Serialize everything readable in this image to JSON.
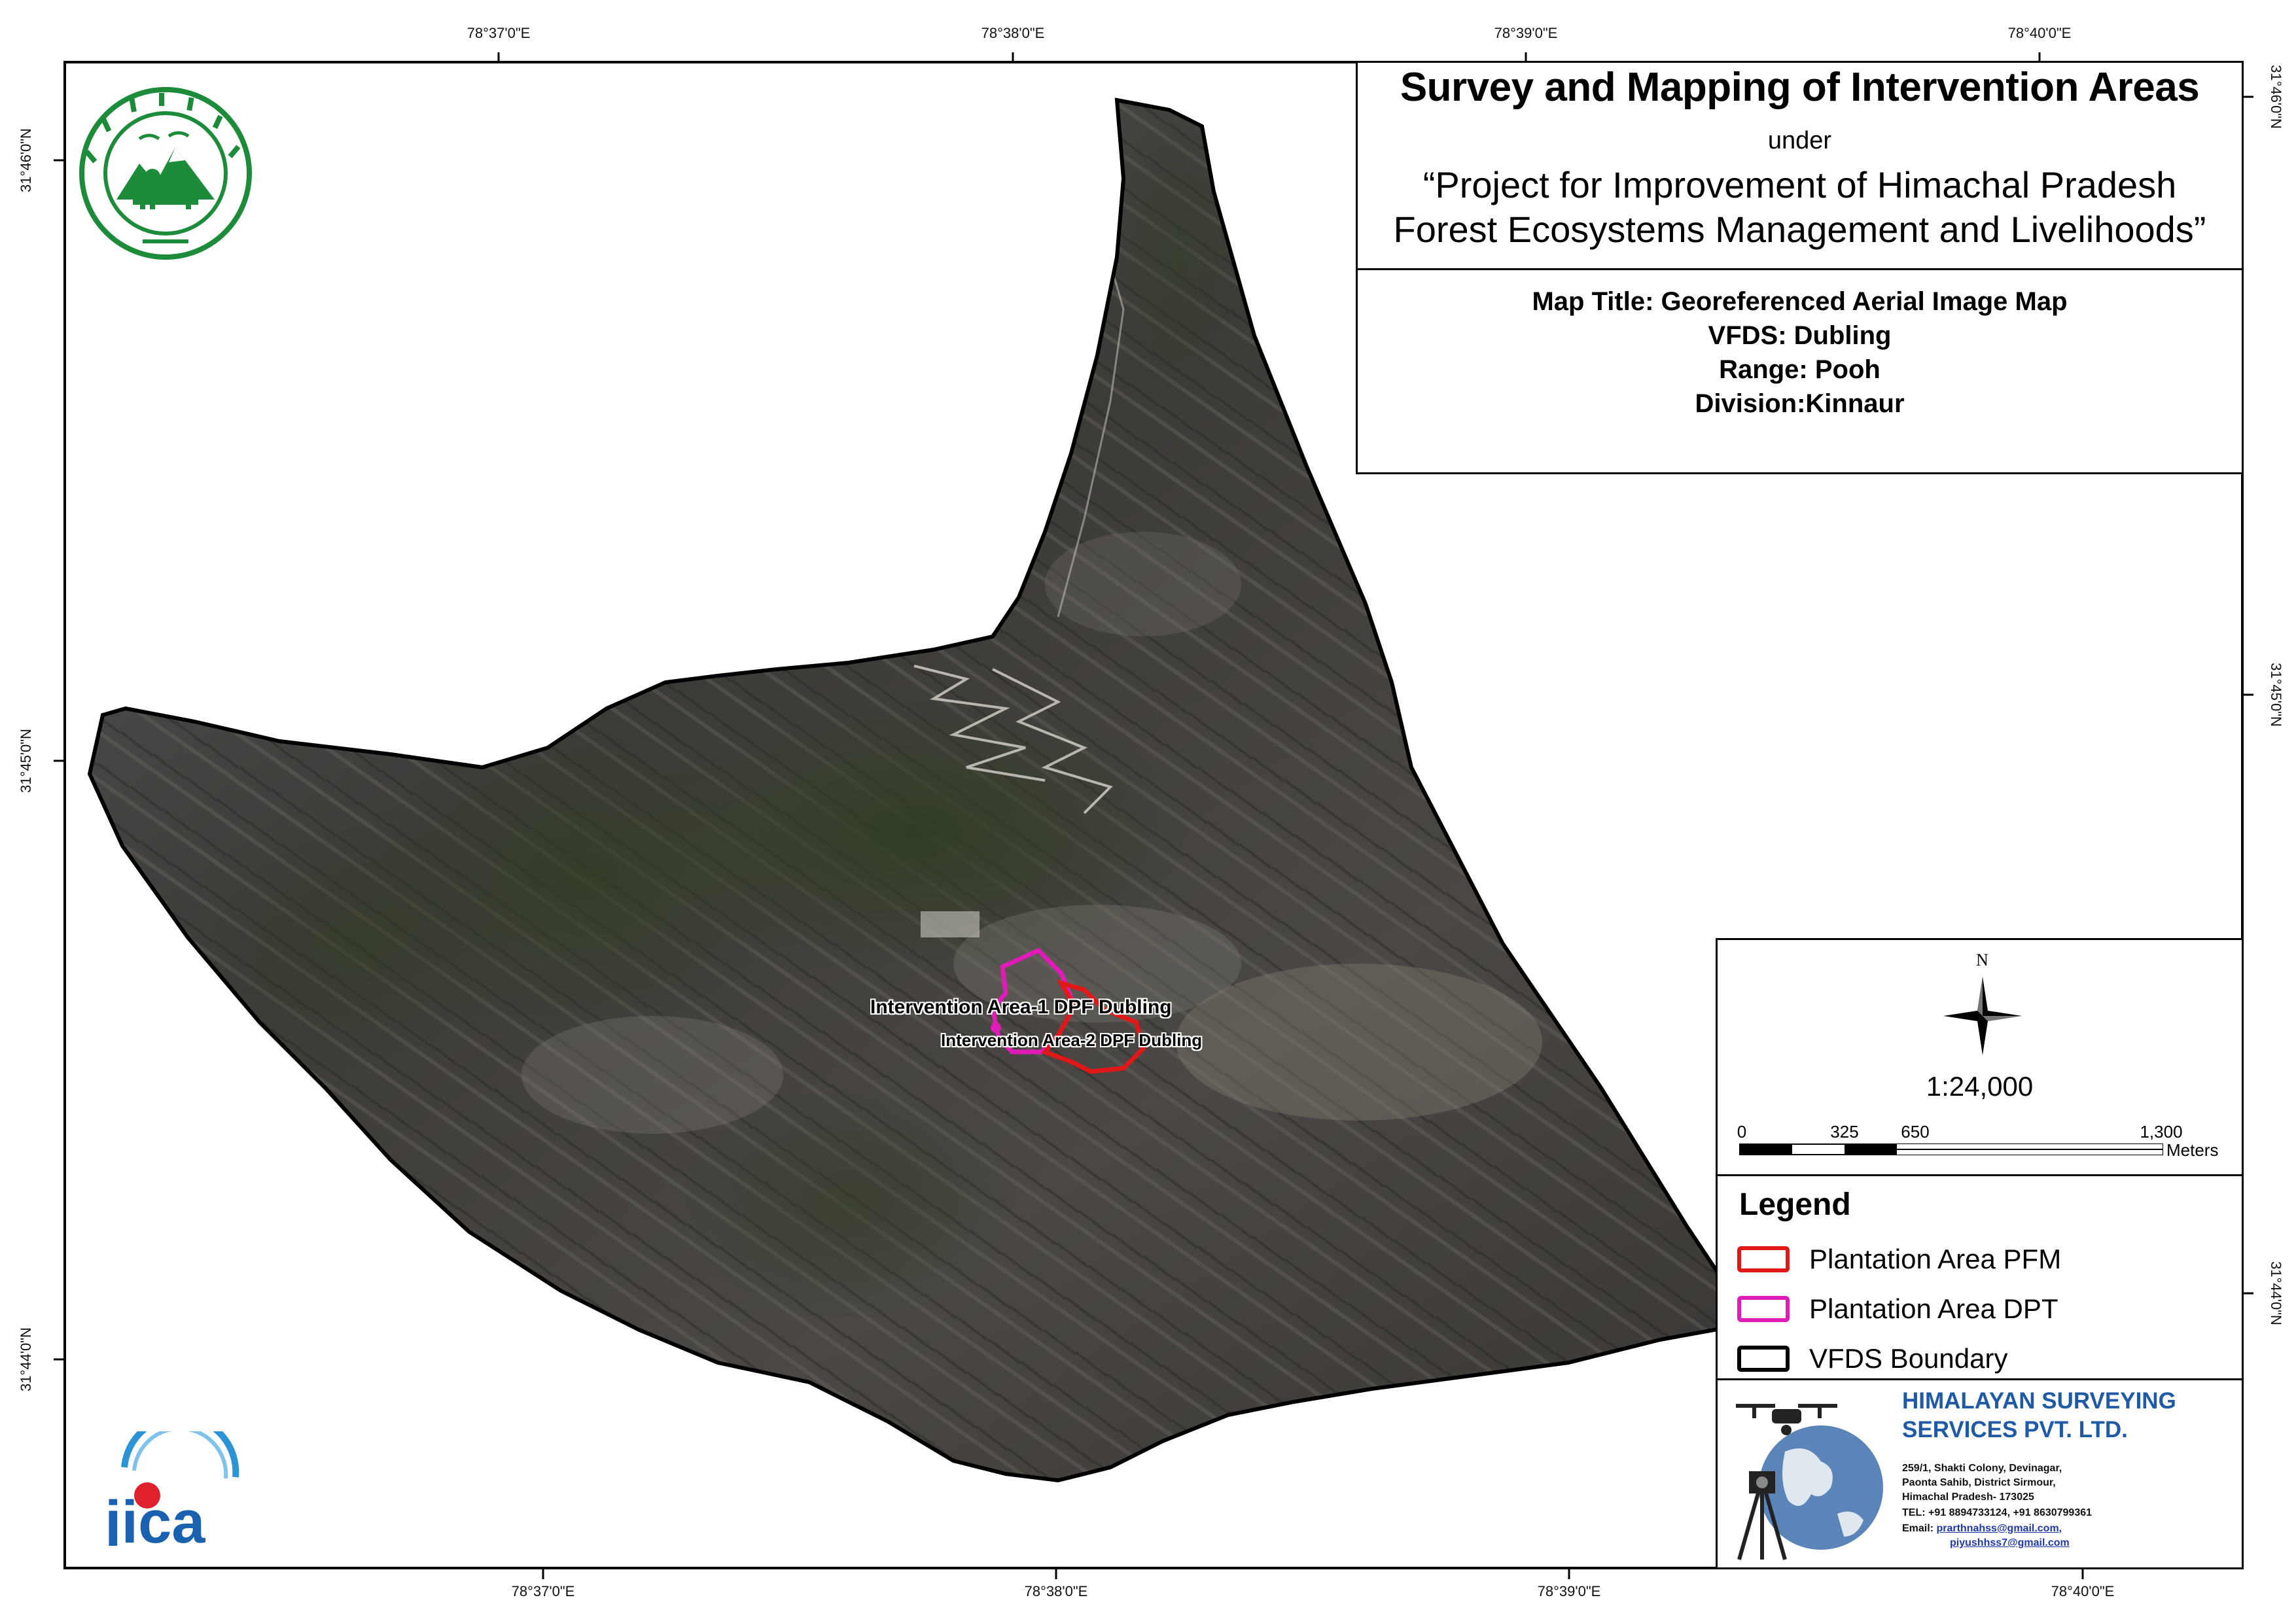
{
  "coordinates": {
    "top": [
      "78°37'0\"E",
      "78°38'0\"E",
      "78°39'0\"E",
      "78°40'0\"E"
    ],
    "bottom": [
      "78°37'0\"E",
      "78°38'0\"E",
      "78°39'0\"E",
      "78°40'0\"E"
    ],
    "left": [
      "31°46'0\"N",
      "31°45'0\"N",
      "31°44'0\"N"
    ],
    "right": [
      "31°46'0\"N",
      "31°45'0\"N",
      "31°44'0\"N"
    ]
  },
  "title": {
    "main": "Survey and Mapping of Intervention Areas",
    "under": "under",
    "project_line_1": "“Project for Improvement of Himachal Pradesh",
    "project_line_2": "Forest Ecosystems Management and Livelihoods”"
  },
  "meta": {
    "map_title": "Map Title: Georeferenced Aerial Image Map",
    "vfds": "VFDS: Dubling",
    "range": "Range: Pooh",
    "division": "Division:Kinnaur"
  },
  "map_labels": {
    "area1": "Intervention Area-1 DPF Dubling",
    "area2": "Intervention Area-2 DPF Dubling"
  },
  "scale": {
    "north": "N",
    "ratio": "1:24,000",
    "ticks": [
      "0",
      "325",
      "650",
      "1,300"
    ],
    "units": "Meters"
  },
  "legend": {
    "title": "Legend",
    "items": [
      {
        "label": "Plantation Area PFM",
        "color": "#e01818"
      },
      {
        "label": "Plantation Area DPT",
        "color": "#e01bb8"
      },
      {
        "label": "VFDS Boundary",
        "color": "#000000"
      }
    ]
  },
  "company": {
    "name_line_1": "HIMALAYAN SURVEYING",
    "name_line_2": "SERVICES PVT. LTD.",
    "address_1": "259/1, Shakti Colony, Devinagar,",
    "address_2": "Paonta Sahib, District Sirmour,",
    "address_3": "Himachal Pradesh- 173025",
    "tel": "TEL: +91 8894733124, +91 8630799361",
    "email_label": "Email: ",
    "email_1": "prarthnahss@gmail.com,",
    "email_2": "piyushhss7@gmail.com"
  },
  "logos": {
    "forest_dept": "forest-department-emblem",
    "jica": "jica"
  },
  "colors": {
    "pfm": "#e01818",
    "dpt": "#e01bb8",
    "company": "#1f5aa6"
  }
}
